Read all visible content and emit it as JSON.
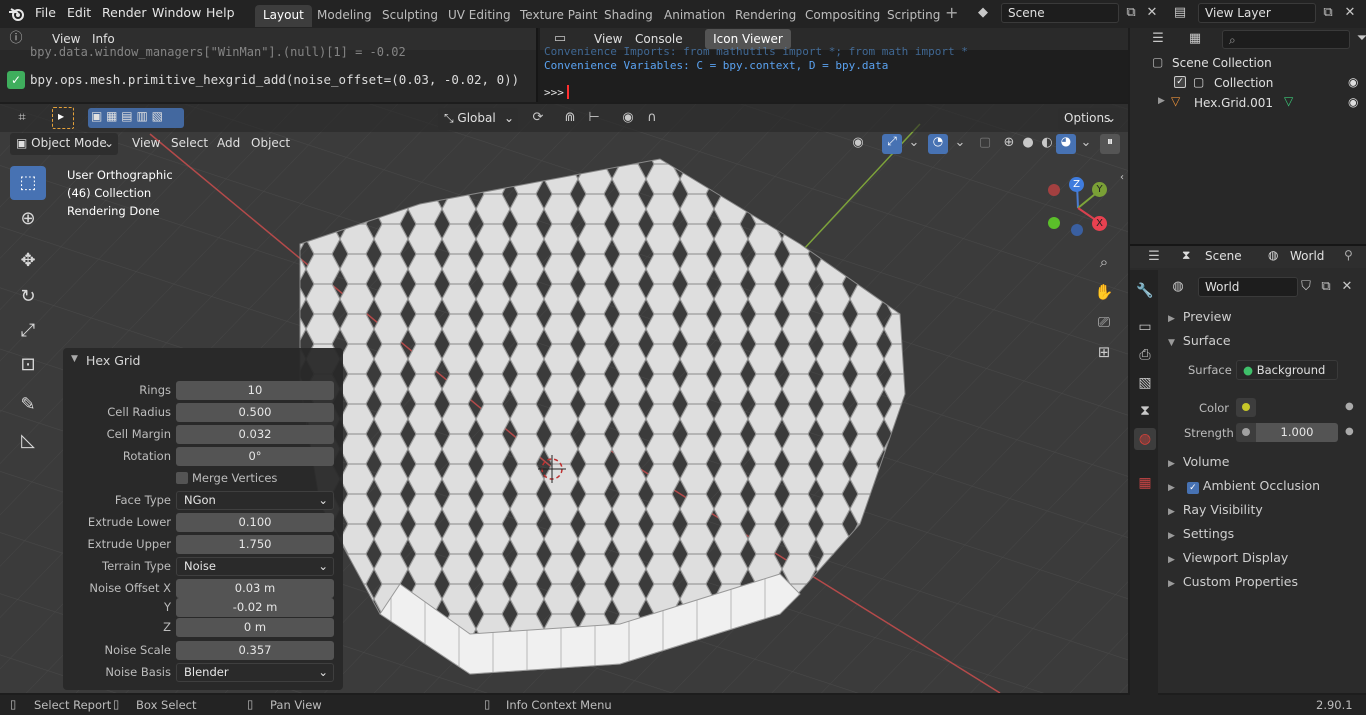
{
  "topbar": {
    "menus": [
      "File",
      "Edit",
      "Render",
      "Window",
      "Help"
    ],
    "workspaces": [
      "Layout",
      "Modeling",
      "Sculpting",
      "UV Editing",
      "Texture Paint",
      "Shading",
      "Animation",
      "Rendering",
      "Compositing",
      "Scripting"
    ],
    "add_tab": "+",
    "scene_name": "Scene",
    "view_layer": "View Layer"
  },
  "info": {
    "menu": [
      "View",
      "Info"
    ],
    "line1": "bpy.data.window_managers[\"WinMan\"].(null)[1] = -0.02",
    "line2": "bpy.ops.mesh.primitive_hexgrid_add(noise_offset=(0.03, -0.02, 0))"
  },
  "console": {
    "menu": [
      "View",
      "Console"
    ],
    "tab": "Icon Viewer",
    "line1": "Convenience Imports:   from mathutils import *; from math import *",
    "line2": "Convenience Variables: C = bpy.context, D = bpy.data",
    "prompt": ">>> "
  },
  "outliner": {
    "root": "Scene Collection",
    "collection": "Collection",
    "object": "Hex.Grid.001"
  },
  "viewport": {
    "orientation": "Global",
    "options": "Options",
    "mode": "Object Mode",
    "menu": [
      "View",
      "Select",
      "Add",
      "Object"
    ],
    "overlay_lines": [
      "User Orthographic",
      "(46) Collection",
      "Rendering Done"
    ],
    "gizmo": {
      "x": "X",
      "y": "Y",
      "z": "Z"
    }
  },
  "operator": {
    "title": "Hex Grid",
    "rows": [
      {
        "label": "Rings",
        "value": "10",
        "kind": "field"
      },
      {
        "label": "Cell Radius",
        "value": "0.500",
        "kind": "field"
      },
      {
        "label": "Cell Margin",
        "value": "0.032",
        "kind": "field"
      },
      {
        "label": "Rotation",
        "value": "0°",
        "kind": "field"
      },
      {
        "label": "",
        "value": "Merge Vertices",
        "kind": "checkbox"
      },
      {
        "label": "Face Type",
        "value": "NGon",
        "kind": "select"
      },
      {
        "label": "Extrude Lower",
        "value": "0.100",
        "kind": "field"
      },
      {
        "label": "Extrude Upper",
        "value": "1.750",
        "kind": "field"
      },
      {
        "label": "Terrain Type",
        "value": "Noise",
        "kind": "select"
      },
      {
        "label": "Noise Offset X",
        "value": "0.03 m",
        "kind": "field"
      },
      {
        "label": "Y",
        "value": "-0.02 m",
        "kind": "field"
      },
      {
        "label": "Z",
        "value": "0 m",
        "kind": "field"
      },
      {
        "label": "Noise Scale",
        "value": "0.357",
        "kind": "field"
      },
      {
        "label": "Noise Basis",
        "value": "Blender",
        "kind": "select"
      }
    ]
  },
  "properties": {
    "tabs": [
      "Scene",
      "World"
    ],
    "world_name": "World",
    "panels": {
      "preview": "Preview",
      "surface": "Surface",
      "surface_label": "Surface",
      "surface_value": "Background",
      "color_label": "Color",
      "strength_label": "Strength",
      "strength_value": "1.000",
      "volume": "Volume",
      "ambient_occlusion": "Ambient Occlusion",
      "ray_visibility": "Ray Visibility",
      "settings": "Settings",
      "viewport_display": "Viewport Display",
      "custom_properties": "Custom Properties"
    }
  },
  "statusbar": {
    "select": "Select Report",
    "box": "Box Select",
    "pan": "Pan View",
    "context": "Info Context Menu",
    "version": "2.90.1"
  }
}
